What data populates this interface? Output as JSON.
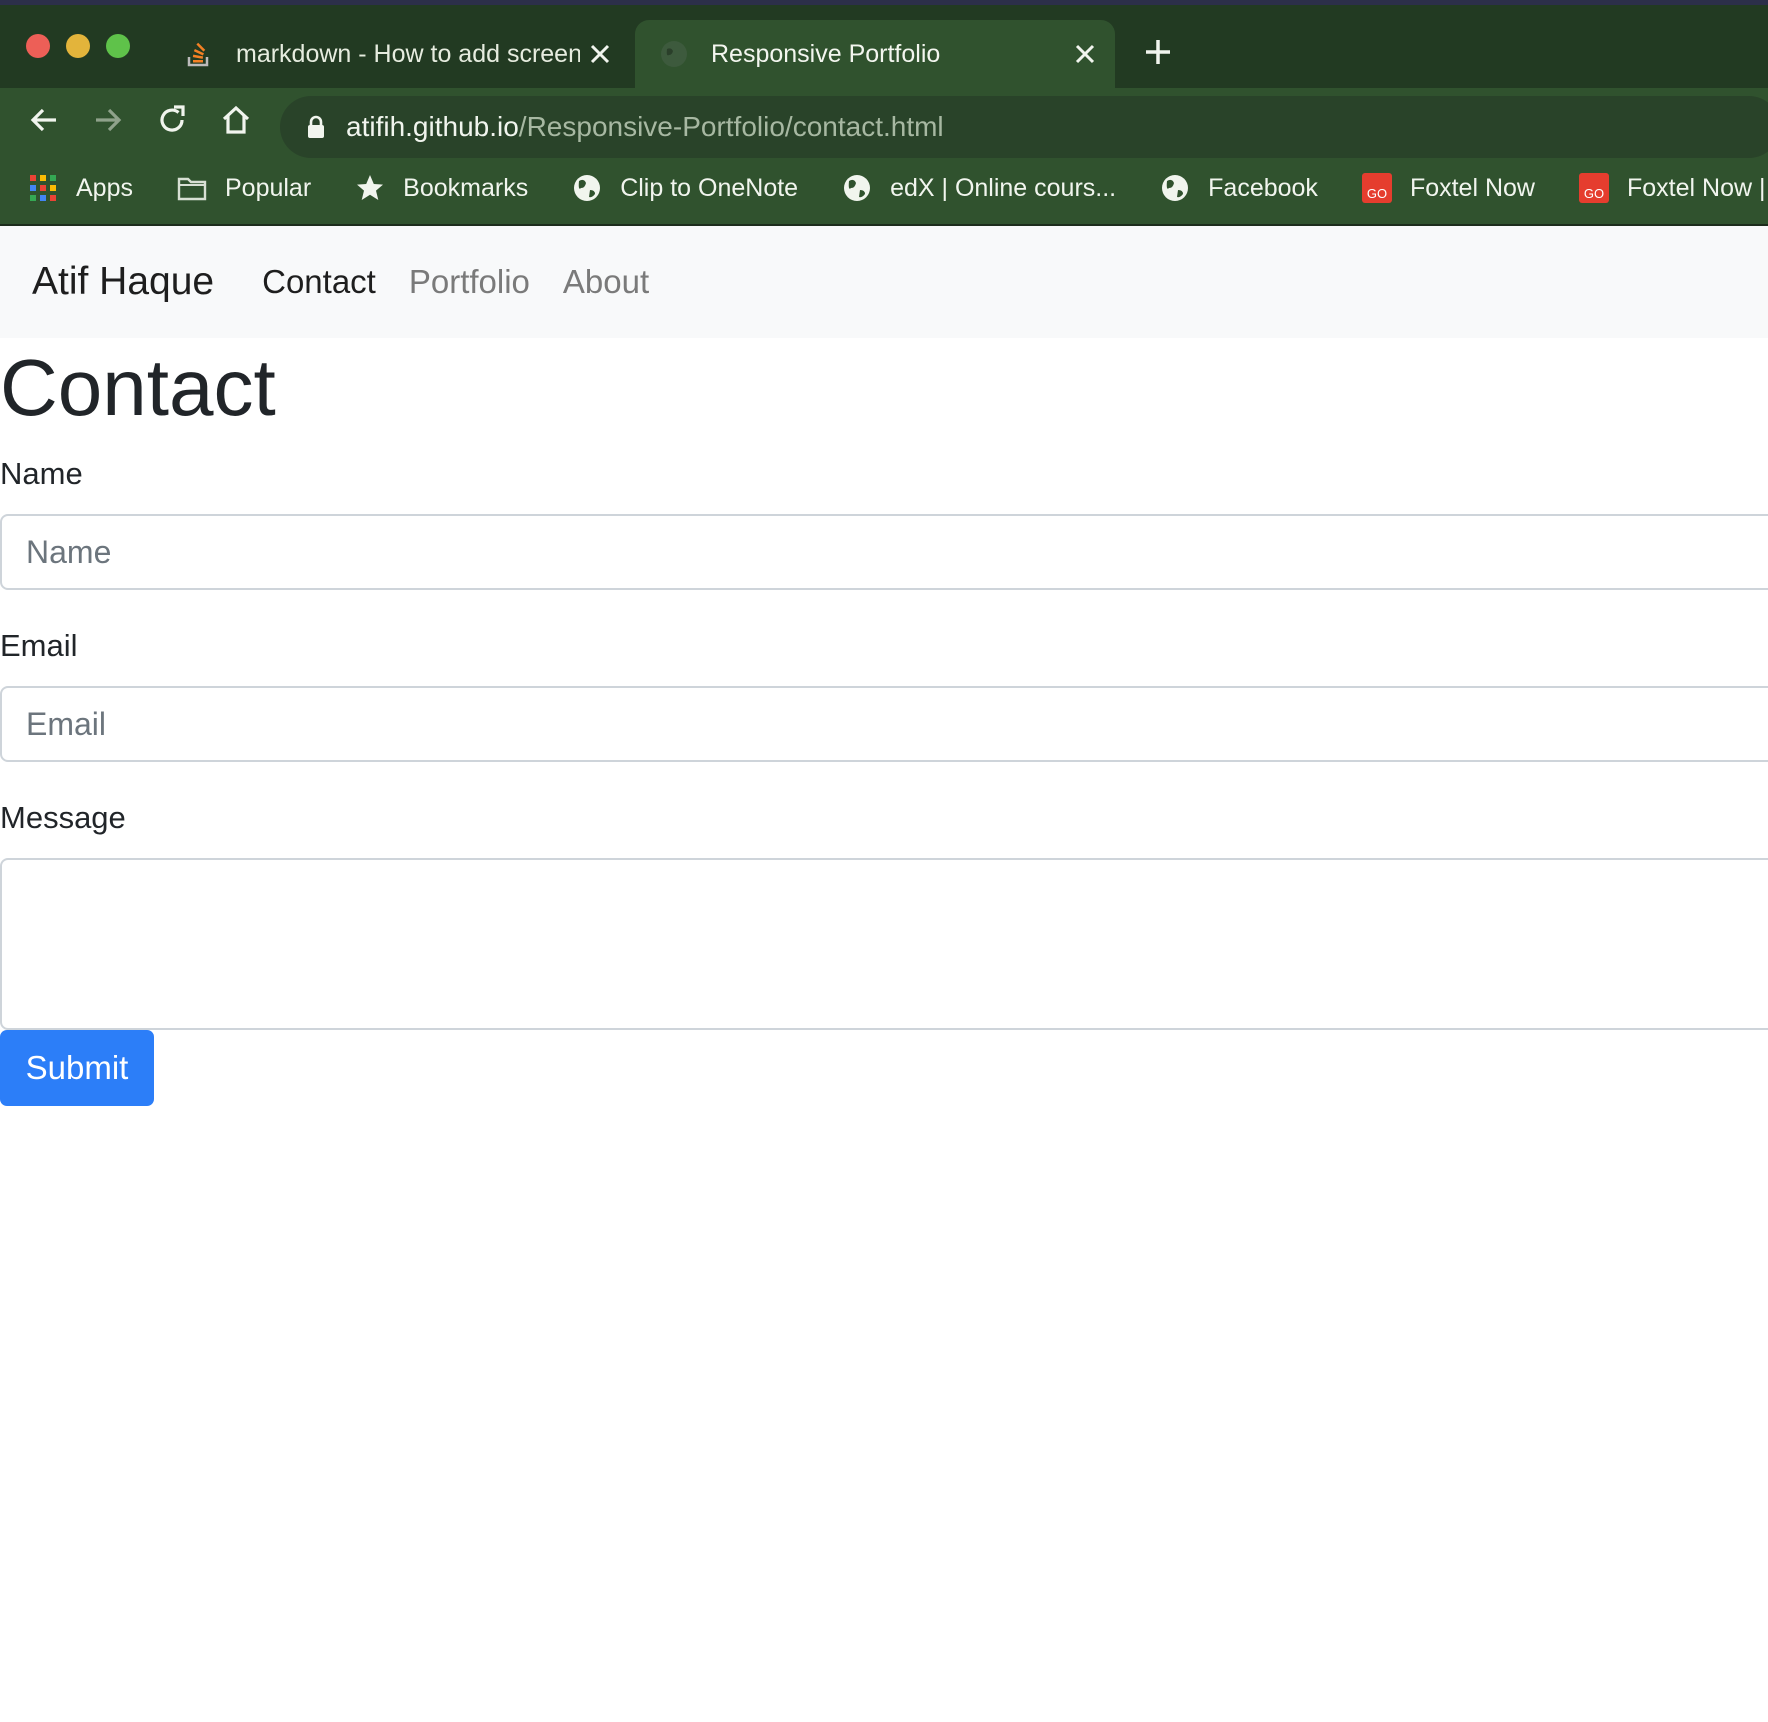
{
  "browser": {
    "tabs": [
      {
        "title": "markdown - How to add screen",
        "active": false
      },
      {
        "title": "Responsive Portfolio",
        "active": true
      }
    ],
    "url_host": "atifih.github.io",
    "url_path": "/Responsive-Portfolio/contact.html",
    "bookmarks": [
      {
        "label": "Apps",
        "icon": "apps-grid-icon"
      },
      {
        "label": "Popular",
        "icon": "folder-icon"
      },
      {
        "label": "Bookmarks",
        "icon": "star-icon"
      },
      {
        "label": "Clip to OneNote",
        "icon": "globe-icon"
      },
      {
        "label": "edX | Online cours...",
        "icon": "globe-icon"
      },
      {
        "label": "Facebook",
        "icon": "globe-icon"
      },
      {
        "label": "Foxtel Now",
        "icon": "foxtel-go-icon"
      },
      {
        "label": "Foxtel Now | Login",
        "icon": "foxtel-go-icon"
      }
    ]
  },
  "navbar": {
    "brand": "Atif Haque",
    "links": [
      {
        "label": "Contact",
        "active": true
      },
      {
        "label": "Portfolio",
        "active": false
      },
      {
        "label": "About",
        "active": false
      }
    ]
  },
  "form": {
    "title": "Contact",
    "name_label": "Name",
    "name_placeholder": "Name",
    "email_label": "Email",
    "email_placeholder": "Email",
    "message_label": "Message",
    "submit_label": "Submit"
  },
  "colors": {
    "chrome_bg": "#30522e",
    "tabstrip_bg": "#223a22",
    "primary_button": "#2c7ef8",
    "navbar_bg": "#f8f9fa"
  }
}
